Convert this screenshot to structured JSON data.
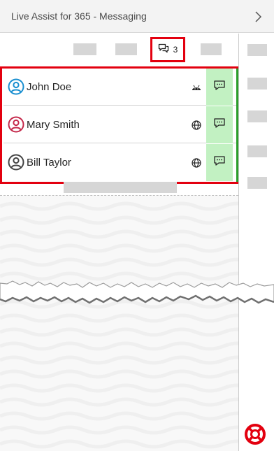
{
  "header": {
    "title": "Live Assist for 365 - Messaging",
    "chevron_icon": "chevron-right-icon"
  },
  "toolbar": {
    "chat_icon": "chat-bubbles-icon",
    "chat_count": "3"
  },
  "conversations": [
    {
      "name": "John Doe",
      "avatar_color": "#1a8fd0",
      "channel_icon": "android-icon",
      "action_icon": "message-icon"
    },
    {
      "name": "Mary Smith",
      "avatar_color": "#c4284a",
      "channel_icon": "globe-icon",
      "action_icon": "message-icon"
    },
    {
      "name": "Bill Taylor",
      "avatar_color": "#444444",
      "channel_icon": "globe-icon",
      "action_icon": "message-icon"
    }
  ],
  "colors": {
    "highlight": "#e3000f",
    "action_bg": "#c2f1c2",
    "active_strip": "#2a9e2a",
    "help": "#e3000f"
  },
  "help": {
    "icon": "lifebuoy-icon"
  }
}
